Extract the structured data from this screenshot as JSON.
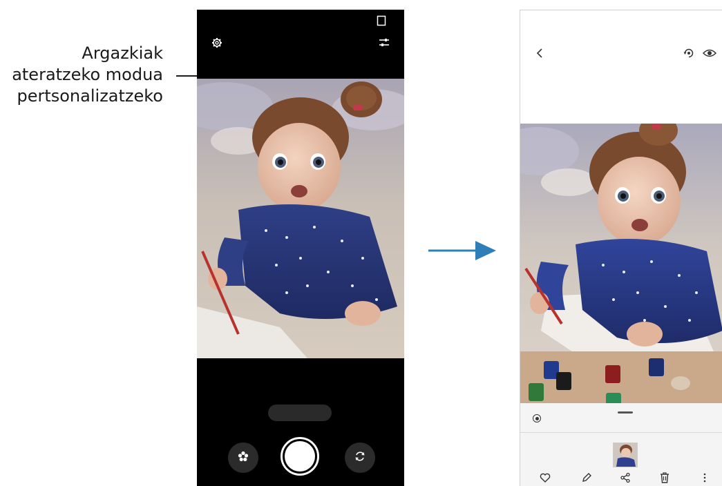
{
  "callout": {
    "lines": [
      "Argazkiak",
      "ateratzeko modua",
      "pertsonalizatzeko"
    ]
  },
  "camera": {
    "icons": {
      "settings": "gear-icon",
      "aspect": "aspect-ratio-icon",
      "customize": "sliders-icon",
      "effects": "effects-icon",
      "switch_camera": "switch-camera-icon",
      "shutter": "shutter-icon"
    },
    "modes": {
      "selected": "",
      "right": ""
    }
  },
  "gallery": {
    "icons": {
      "back": "back-icon",
      "remaster": "remaster-icon",
      "view": "eye-icon",
      "favorite": "heart-icon",
      "edit": "pencil-icon",
      "share": "share-icon",
      "delete": "trash-icon",
      "more": "more-icon"
    },
    "single_take_label": ""
  },
  "colors": {
    "callout_line": "#1a1a1a",
    "arrow": "#2e7fb8",
    "camera_bg": "#000000",
    "gallery_panel": "#f4f4f4"
  }
}
